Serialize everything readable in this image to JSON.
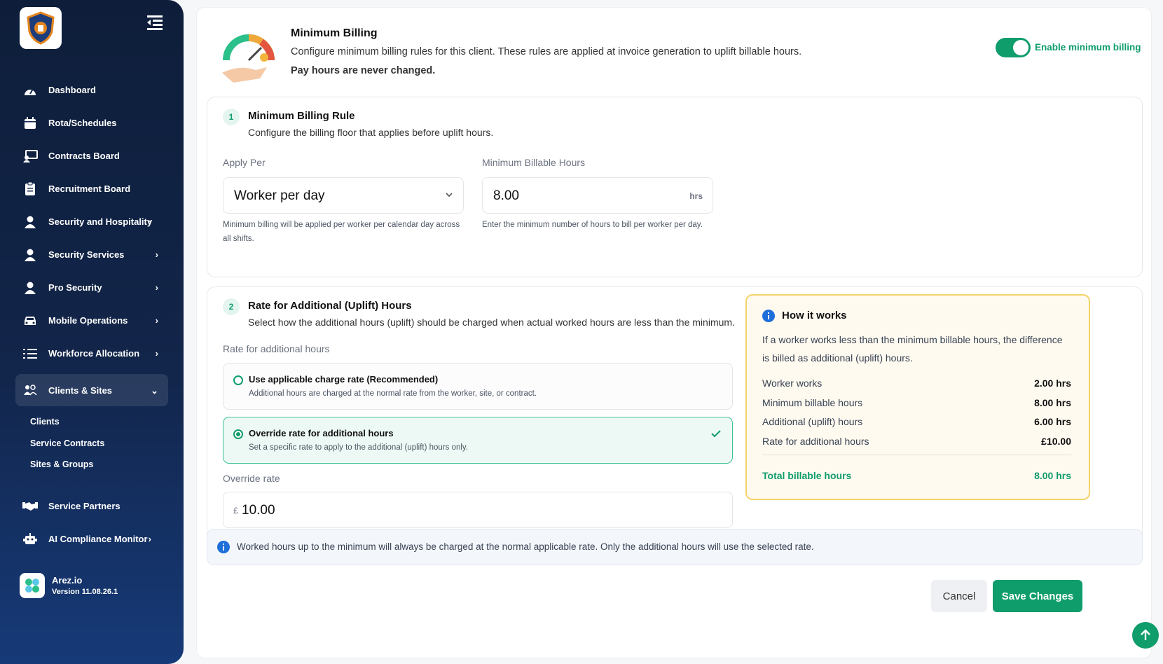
{
  "sidebar": {
    "items": [
      {
        "label": "Dashboard",
        "icon": "dashboard-icon"
      },
      {
        "label": "Rota/Schedules",
        "icon": "calendar-icon"
      },
      {
        "label": "Contracts Board",
        "icon": "contracts-icon"
      },
      {
        "label": "Recruitment Board",
        "icon": "clipboard-icon"
      },
      {
        "label": "Security and Hospitality",
        "icon": "user-icon"
      },
      {
        "label": "Security Services",
        "icon": "user-icon"
      },
      {
        "label": "Pro Security",
        "icon": "user-icon"
      },
      {
        "label": "Mobile Operations",
        "icon": "car-icon"
      },
      {
        "label": "Workforce Allocation",
        "icon": "list-icon"
      },
      {
        "label": "Clients & Sites",
        "icon": "clients-icon"
      },
      {
        "label": "Service Partners",
        "icon": "handshake-icon"
      },
      {
        "label": "AI Compliance Monitor",
        "icon": "robot-icon"
      }
    ],
    "sub_items": [
      "Clients",
      "Service Contracts",
      "Sites & Groups"
    ],
    "footer": {
      "name": "Arez.io",
      "version": "Version 11.08.26.1"
    }
  },
  "header": {
    "title": "Minimum Billing",
    "description": "Configure minimum billing rules for this client. These rules are applied at invoice generation to uplift billable hours.",
    "note": "Pay hours are never changed.",
    "toggle_label": "Enable minimum billing",
    "toggle_on": true
  },
  "rule": {
    "step": "1",
    "title": "Minimum Billing Rule",
    "description": "Configure the billing floor that applies before uplift hours.",
    "apply_per_label": "Apply Per",
    "apply_per_value": "Worker per day",
    "apply_per_help": "Minimum billing will be applied per worker per calendar day across all shifts.",
    "min_hours_label": "Minimum Billable Hours",
    "min_hours_value": "8.00",
    "min_hours_unit": "hrs",
    "min_hours_help": "Enter the minimum number of hours to bill per worker per day."
  },
  "uplift": {
    "step": "2",
    "title": "Rate for Additional (Uplift) Hours",
    "description": "Select how the additional hours (uplift) should be charged when actual worked hours are less than the minimum.",
    "rate_label": "Rate for additional hours",
    "options": [
      {
        "title": "Use applicable charge rate (Recommended)",
        "desc": "Additional hours are charged at the normal rate from the worker, site, or contract.",
        "selected": false
      },
      {
        "title": "Override rate for additional hours",
        "desc": "Set a specific rate to apply to the additional (uplift) hours only.",
        "selected": true
      }
    ],
    "override_label": "Override rate",
    "currency": "£",
    "override_value": "10.00"
  },
  "how": {
    "title": "How it works",
    "description": "If a worker works less than the minimum billable hours, the difference is billed as additional (uplift) hours.",
    "rows": [
      {
        "label": "Worker works",
        "value": "2.00 hrs"
      },
      {
        "label": "Minimum billable hours",
        "value": "8.00 hrs"
      },
      {
        "label": "Additional (uplift) hours",
        "value": "6.00 hrs"
      },
      {
        "label": "Rate for additional hours",
        "value": "£10.00"
      }
    ],
    "total_label": "Total billable hours",
    "total_value": "8.00 hrs"
  },
  "info": {
    "text": "Worked hours up to the minimum will always be charged at the normal applicable rate. Only the additional hours will use the selected rate."
  },
  "actions": {
    "cancel": "Cancel",
    "save": "Save Changes"
  },
  "colors": {
    "accent": "#0f9d6b",
    "sidebar": "#12254a",
    "highlight": "#f4d36b"
  }
}
